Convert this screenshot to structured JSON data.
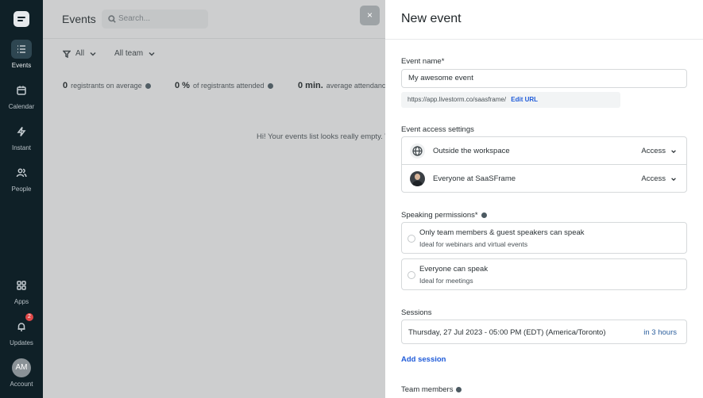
{
  "sidebar": {
    "items": [
      {
        "label": "Events",
        "icon": "list-icon"
      },
      {
        "label": "Calendar",
        "icon": "calendar-icon"
      },
      {
        "label": "Instant",
        "icon": "lightning-icon"
      },
      {
        "label": "People",
        "icon": "people-icon"
      },
      {
        "label": "Apps",
        "icon": "grid-icon"
      },
      {
        "label": "Updates",
        "icon": "bell-icon",
        "badge": "2"
      },
      {
        "label": "Account",
        "avatar": "AM"
      }
    ]
  },
  "main": {
    "title": "Events",
    "search_placeholder": "Search...",
    "filters": {
      "all": "All",
      "team": "All team"
    },
    "stats": [
      {
        "value": "0",
        "label": "registrants on average"
      },
      {
        "value": "0 %",
        "label": "of registrants attended"
      },
      {
        "value": "0 min.",
        "label": "average attendance"
      }
    ],
    "empty_text": "Hi! Your events list looks really empty. W",
    "close": "×"
  },
  "panel": {
    "title": "New event",
    "event_name_label": "Event name*",
    "event_name_value": "My awesome event",
    "url": "https://app.livestorm.co/saasframe/",
    "edit_url": "Edit URL",
    "access_label": "Event access settings",
    "access_rows": [
      {
        "text": "Outside the workspace",
        "access": "Access"
      },
      {
        "text": "Everyone at SaaSFrame",
        "access": "Access"
      }
    ],
    "speaking_label": "Speaking permissions*",
    "speaking_options": [
      {
        "title": "Only team members & guest speakers can speak",
        "subtitle": "Ideal for webinars and virtual events"
      },
      {
        "title": "Everyone can speak",
        "subtitle": "Ideal for meetings"
      }
    ],
    "sessions_label": "Sessions",
    "session_datetime": "Thursday, 27 Jul 2023 - 05:00 PM (EDT) (America/Toronto)",
    "session_relative": "in 3 hours",
    "add_session": "Add session",
    "team_members_label": "Team members"
  }
}
